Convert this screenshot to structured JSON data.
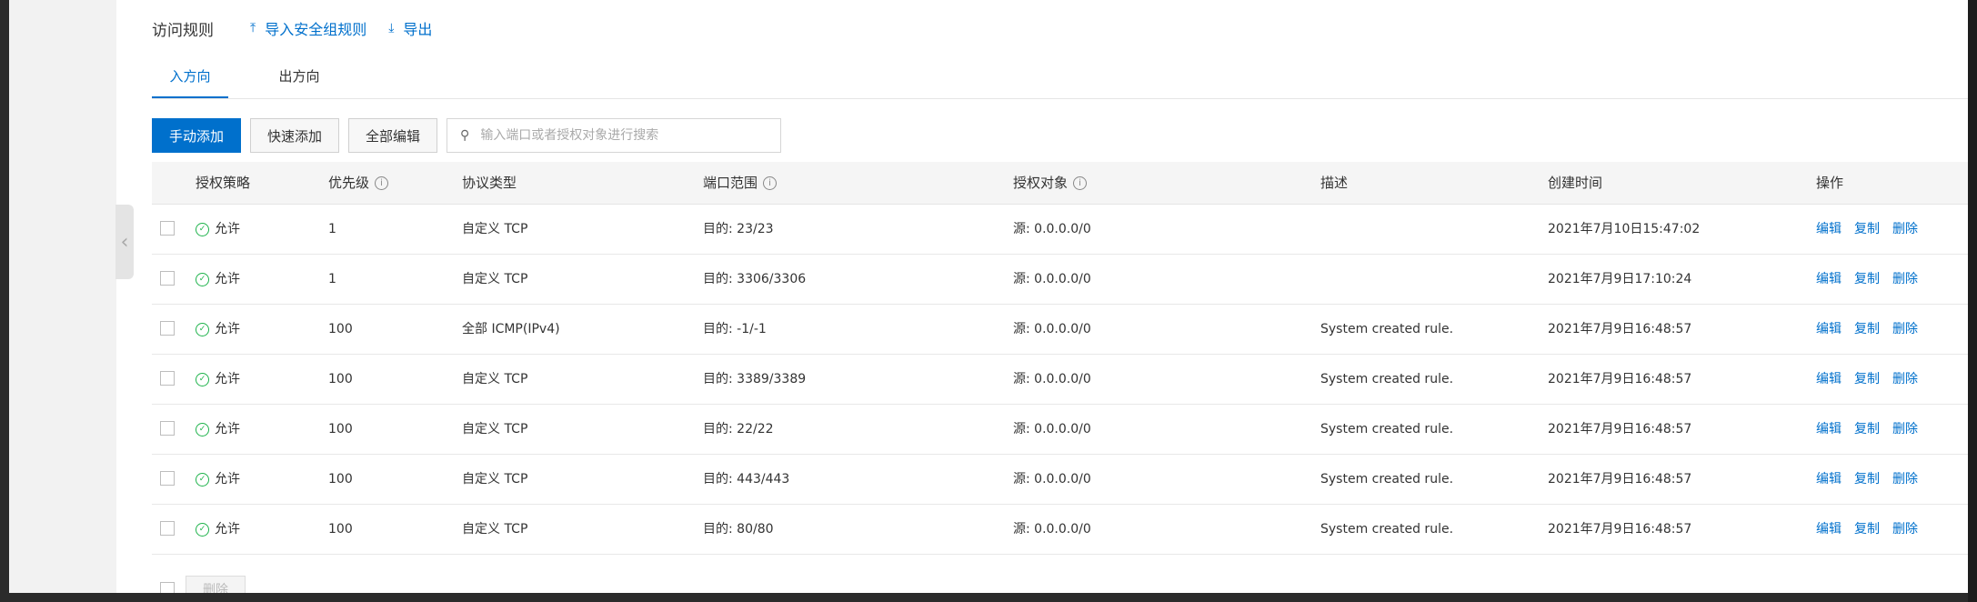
{
  "header": {
    "title": "访问规则",
    "import_label": "导入安全组规则",
    "export_label": "导出"
  },
  "tabs": [
    {
      "label": "入方向",
      "active": true
    },
    {
      "label": "出方向",
      "active": false
    }
  ],
  "toolbar": {
    "manual_add": "手动添加",
    "quick_add": "快速添加",
    "edit_all": "全部编辑",
    "search_placeholder": "输入端口或者授权对象进行搜索"
  },
  "table": {
    "columns": {
      "policy": "授权策略",
      "priority": "优先级",
      "protocol": "协议类型",
      "port_range": "端口范围",
      "auth_object": "授权对象",
      "description": "描述",
      "created": "创建时间",
      "actions": "操作"
    },
    "action_labels": {
      "edit": "编辑",
      "copy": "复制",
      "delete": "删除"
    },
    "rows": [
      {
        "policy": "允许",
        "priority": "1",
        "protocol": "自定义 TCP",
        "port": "目的: 23/23",
        "object": "源: 0.0.0.0/0",
        "desc": "",
        "created": "2021年7月10日15:47:02"
      },
      {
        "policy": "允许",
        "priority": "1",
        "protocol": "自定义 TCP",
        "port": "目的: 3306/3306",
        "object": "源: 0.0.0.0/0",
        "desc": "",
        "created": "2021年7月9日17:10:24"
      },
      {
        "policy": "允许",
        "priority": "100",
        "protocol": "全部 ICMP(IPv4)",
        "port": "目的: -1/-1",
        "object": "源: 0.0.0.0/0",
        "desc": "System created rule.",
        "created": "2021年7月9日16:48:57"
      },
      {
        "policy": "允许",
        "priority": "100",
        "protocol": "自定义 TCP",
        "port": "目的: 3389/3389",
        "object": "源: 0.0.0.0/0",
        "desc": "System created rule.",
        "created": "2021年7月9日16:48:57"
      },
      {
        "policy": "允许",
        "priority": "100",
        "protocol": "自定义 TCP",
        "port": "目的: 22/22",
        "object": "源: 0.0.0.0/0",
        "desc": "System created rule.",
        "created": "2021年7月9日16:48:57"
      },
      {
        "policy": "允许",
        "priority": "100",
        "protocol": "自定义 TCP",
        "port": "目的: 443/443",
        "object": "源: 0.0.0.0/0",
        "desc": "System created rule.",
        "created": "2021年7月9日16:48:57"
      },
      {
        "policy": "允许",
        "priority": "100",
        "protocol": "自定义 TCP",
        "port": "目的: 80/80",
        "object": "源: 0.0.0.0/0",
        "desc": "System created rule.",
        "created": "2021年7月9日16:48:57"
      }
    ]
  },
  "footer": {
    "delete_label": "删除"
  },
  "colors": {
    "accent": "#0070cc",
    "success": "#1fb34c"
  }
}
